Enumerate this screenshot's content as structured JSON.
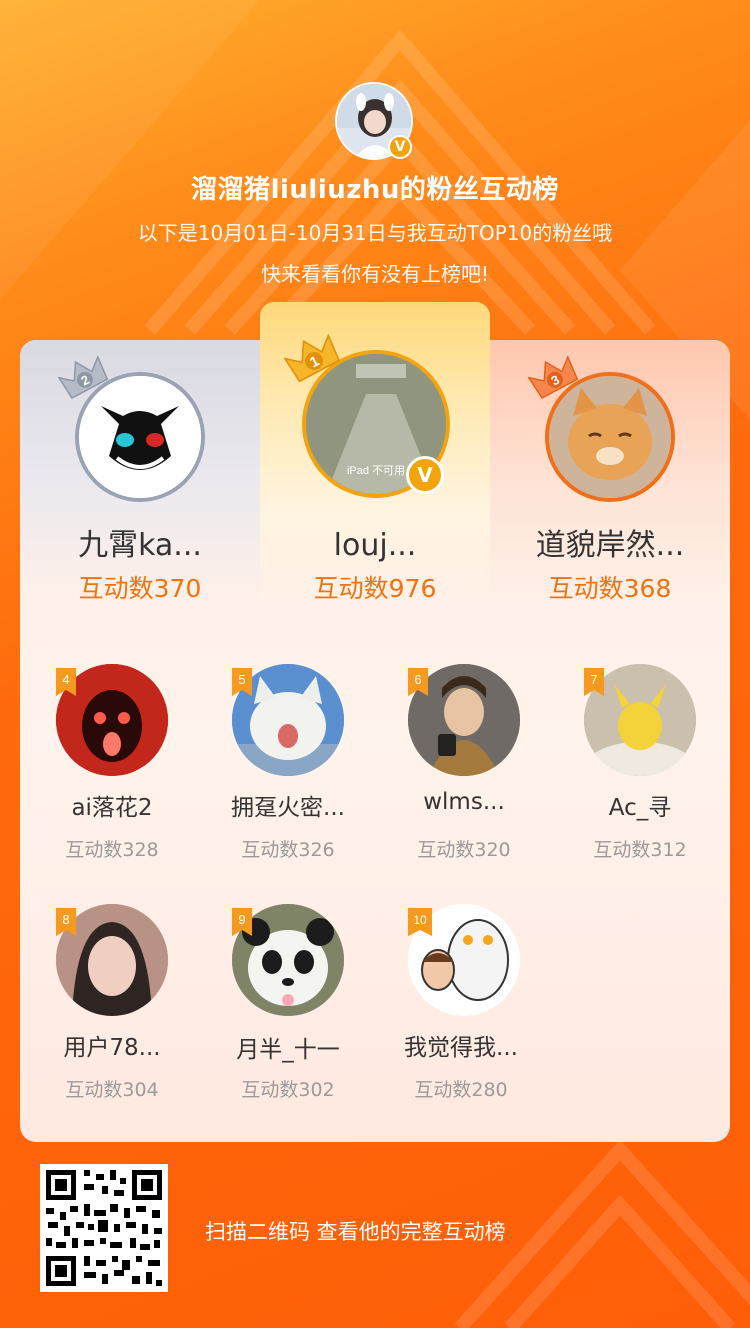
{
  "header": {
    "title": "溜溜猪liuliuzhu的粉丝互动榜",
    "subtitle_line1": "以下是10月01日-10月31日与我互动TOP10的粉丝哦",
    "subtitle_line2": "快来看看你有没有上榜吧!",
    "verified_mark": "V"
  },
  "top3": [
    {
      "rank": "2",
      "name": "九霄ka...",
      "count": "互动数370"
    },
    {
      "rank": "1",
      "name": "louj...",
      "count": "互动数976"
    },
    {
      "rank": "3",
      "name": "道貌岸然...",
      "count": "互动数368"
    }
  ],
  "rest": [
    {
      "rank": "4",
      "name": "ai落花2",
      "count": "互动数328"
    },
    {
      "rank": "5",
      "name": "拥趸火密...",
      "count": "互动数326"
    },
    {
      "rank": "6",
      "name": "wlms...",
      "count": "互动数320"
    },
    {
      "rank": "7",
      "name": "Ac_寻",
      "count": "互动数312"
    },
    {
      "rank": "8",
      "name": "用户78...",
      "count": "互动数304"
    },
    {
      "rank": "9",
      "name": "月半_十一",
      "count": "互动数302"
    },
    {
      "rank": "10",
      "name": "我觉得我...",
      "count": "互动数280"
    }
  ],
  "footer": {
    "qr_text": "扫描二维码 查看他的完整互动榜"
  },
  "colors": {
    "accent_orange": "#f0730f",
    "gold": "#f3a30d",
    "silver": "#9aa3b3",
    "bronze": "#f26f1a"
  },
  "icons": [
    "crown-icon",
    "verified-icon",
    "rank-flag-icon",
    "qr-code"
  ]
}
